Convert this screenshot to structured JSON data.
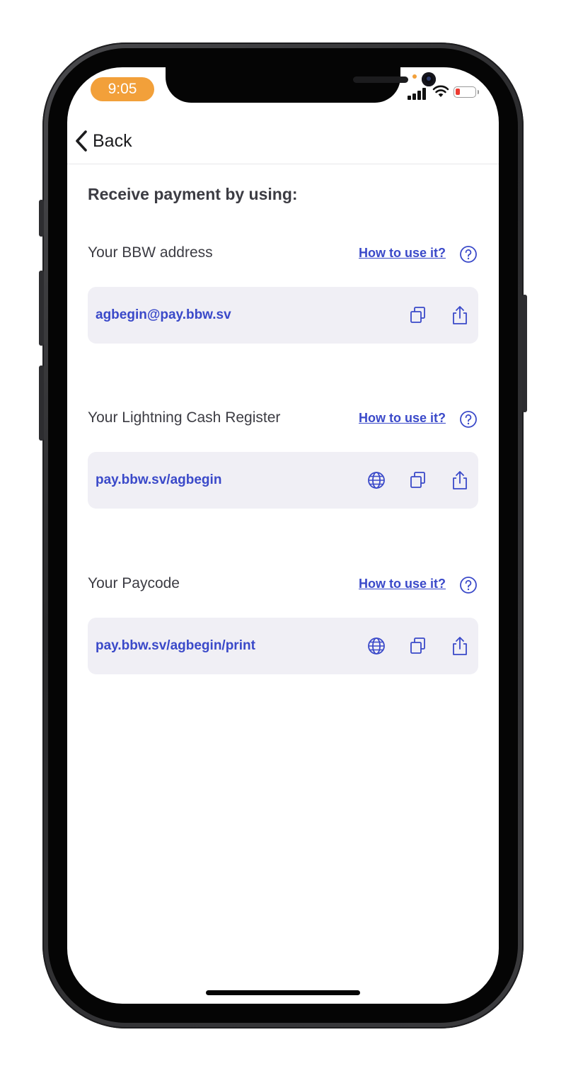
{
  "status_bar": {
    "time": "9:05",
    "time_pill_color": "#f2a03a",
    "battery_color": "#ec3b32"
  },
  "nav": {
    "back_label": "Back"
  },
  "page": {
    "heading": "Receive payment by using:"
  },
  "sections": [
    {
      "label": "Your BBW address",
      "help_link": "How to use it?",
      "value": "agbegin@pay.bbw.sv",
      "icons": [
        "copy-icon",
        "share-icon"
      ]
    },
    {
      "label": "Your Lightning Cash Register",
      "help_link": "How to use it?",
      "value": "pay.bbw.sv/agbegin",
      "icons": [
        "globe-icon",
        "copy-icon",
        "share-icon"
      ]
    },
    {
      "label": "Your Paycode",
      "help_link": "How to use it?",
      "value": "pay.bbw.sv/agbegin/print",
      "icons": [
        "globe-icon",
        "copy-icon",
        "share-icon"
      ]
    }
  ],
  "colors": {
    "accent": "#3a49c9",
    "card_background": "#f0eff5",
    "label_text": "#3c3c43"
  }
}
